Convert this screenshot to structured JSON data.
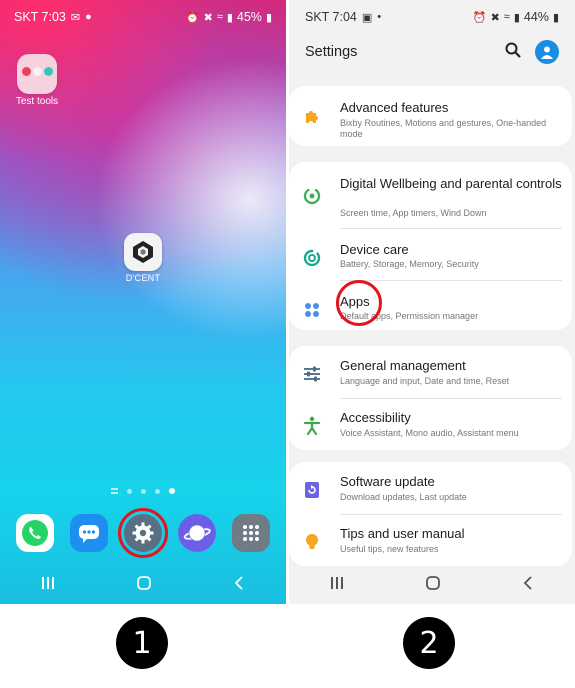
{
  "screen1": {
    "status": {
      "carrier_time": "SKT 7:03",
      "battery": "45%"
    },
    "folder": {
      "label": "Test tools"
    },
    "app_dcent": {
      "label": "D'CENT"
    },
    "dock": [
      "WhatsApp",
      "Messages",
      "Settings",
      "Internet",
      "Apps"
    ],
    "highlighted_app": "Settings"
  },
  "screen2": {
    "status": {
      "carrier_time": "SKT 7:04",
      "battery": "44%"
    },
    "title": "Settings",
    "groups": [
      {
        "items": [
          {
            "title": "Advanced features",
            "subtitle": "Bixby Routines, Motions and gestures, One-handed mode",
            "icon": "puzzle-icon",
            "color": "#f5a623"
          }
        ]
      },
      {
        "items": [
          {
            "title": "Digital Wellbeing and parental controls",
            "subtitle": "Screen time, App timers, Wind Down",
            "icon": "wellbeing-icon",
            "color": "#3fae5a"
          },
          {
            "title": "Device care",
            "subtitle": "Battery, Storage, Memory, Security",
            "icon": "device-care-icon",
            "color": "#1aa892"
          },
          {
            "title": "Apps",
            "subtitle": "Default apps, Permission manager",
            "icon": "apps-grid-icon",
            "color": "#4a8ff0"
          }
        ]
      },
      {
        "items": [
          {
            "title": "General management",
            "subtitle": "Language and input, Date and time, Reset",
            "icon": "sliders-icon",
            "color": "#4b6a8a"
          },
          {
            "title": "Accessibility",
            "subtitle": "Voice Assistant, Mono audio, Assistant menu",
            "icon": "accessibility-icon",
            "color": "#3fa84c"
          }
        ]
      },
      {
        "items": [
          {
            "title": "Software update",
            "subtitle": "Download updates, Last update",
            "icon": "software-update-icon",
            "color": "#6a66e0"
          },
          {
            "title": "Tips and user manual",
            "subtitle": "Useful tips, new features",
            "icon": "lightbulb-icon",
            "color": "#f5a623"
          }
        ]
      }
    ],
    "highlighted_item": "Apps"
  },
  "steps": [
    "1",
    "2"
  ],
  "colors": {
    "highlight_ring": "#e5141c"
  }
}
